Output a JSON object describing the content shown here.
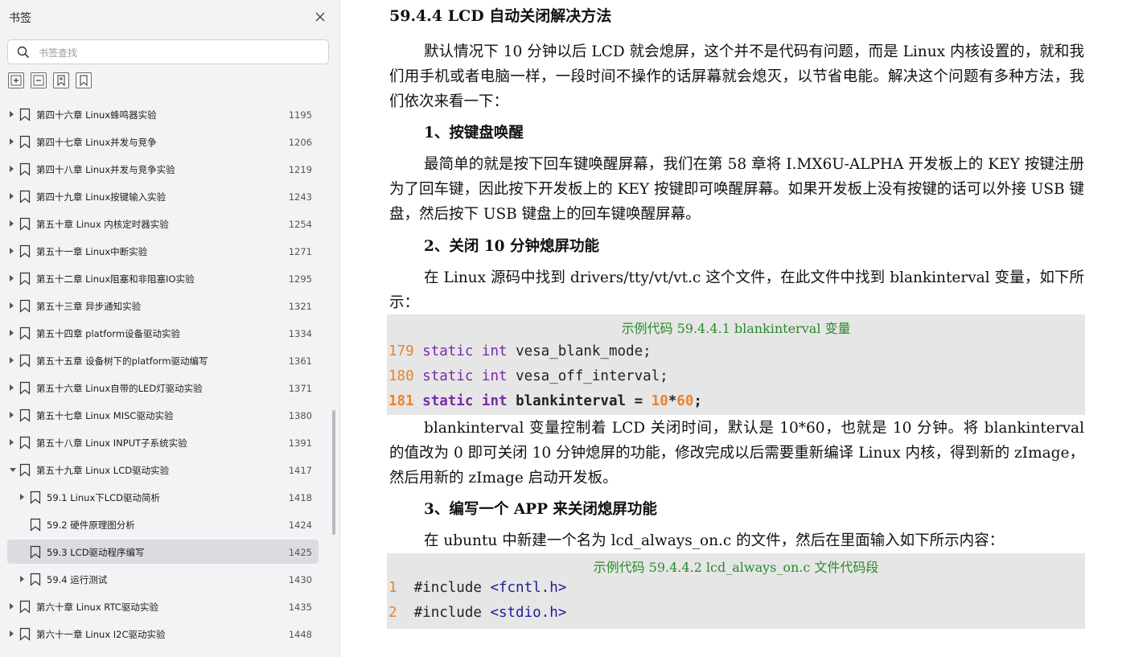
{
  "sidebar": {
    "title": "书签",
    "search_placeholder": "书签查找",
    "toc": [
      {
        "label": "第四十六章 Linux蜂鸣器实验",
        "page": "1195",
        "level": 0,
        "expand": "right",
        "active": false
      },
      {
        "label": "第四十七章 Linux并发与竞争",
        "page": "1206",
        "level": 0,
        "expand": "right",
        "active": false
      },
      {
        "label": "第四十八章 Linux并发与竞争实验",
        "page": "1219",
        "level": 0,
        "expand": "right",
        "active": false
      },
      {
        "label": "第四十九章 Linux按键输入实验",
        "page": "1243",
        "level": 0,
        "expand": "right",
        "active": false
      },
      {
        "label": "第五十章 Linux 内核定时器实验",
        "page": "1254",
        "level": 0,
        "expand": "right",
        "active": false
      },
      {
        "label": "第五十一章 Linux中断实验",
        "page": "1271",
        "level": 0,
        "expand": "right",
        "active": false
      },
      {
        "label": "第五十二章 Linux阻塞和非阻塞IO实验",
        "page": "1295",
        "level": 0,
        "expand": "right",
        "active": false
      },
      {
        "label": "第五十三章 异步通知实验",
        "page": "1321",
        "level": 0,
        "expand": "right",
        "active": false
      },
      {
        "label": "第五十四章 platform设备驱动实验",
        "page": "1334",
        "level": 0,
        "expand": "right",
        "active": false
      },
      {
        "label": "第五十五章 设备树下的platform驱动编写",
        "page": "1361",
        "level": 0,
        "expand": "right",
        "active": false
      },
      {
        "label": "第五十六章 Linux自带的LED灯驱动实验",
        "page": "1371",
        "level": 0,
        "expand": "right",
        "active": false
      },
      {
        "label": "第五十七章 Linux MISC驱动实验",
        "page": "1380",
        "level": 0,
        "expand": "right",
        "active": false
      },
      {
        "label": "第五十八章 Linux INPUT子系统实验",
        "page": "1391",
        "level": 0,
        "expand": "right",
        "active": false
      },
      {
        "label": "第五十九章 Linux LCD驱动实验",
        "page": "1417",
        "level": 0,
        "expand": "down",
        "active": false
      },
      {
        "label": "59.1 Linux下LCD驱动简析",
        "page": "1418",
        "level": 1,
        "expand": "right",
        "active": false
      },
      {
        "label": "59.2 硬件原理图分析",
        "page": "1424",
        "level": 1,
        "expand": "none",
        "active": false
      },
      {
        "label": "59.3 LCD驱动程序编写",
        "page": "1425",
        "level": 1,
        "expand": "none",
        "active": true
      },
      {
        "label": "59.4 运行测试",
        "page": "1430",
        "level": 1,
        "expand": "right",
        "active": false
      },
      {
        "label": "第六十章 Linux RTC驱动实验",
        "page": "1435",
        "level": 0,
        "expand": "right",
        "active": false
      },
      {
        "label": "第六十一章 Linux I2C驱动实验",
        "page": "1448",
        "level": 0,
        "expand": "right",
        "active": false
      }
    ]
  },
  "doc": {
    "section_title": "59.4.4 LCD 自动关闭解决方法",
    "p1": "默认情况下 10 分钟以后 LCD 就会熄屏，这个并不是代码有问题，而是 Linux 内核设置的，就和我们用手机或者电脑一样，一段时间不操作的话屏幕就会熄灭，以节省电能。解决这个问题有多种方法，我们依次来看一下：",
    "h1": "1、按键盘唤醒",
    "p2": "最简单的就是按下回车键唤醒屏幕，我们在第 58 章将 I.MX6U-ALPHA 开发板上的 KEY 按键注册为了回车键，因此按下开发板上的 KEY 按键即可唤醒屏幕。如果开发板上没有按键的话可以外接 USB 键盘，然后按下 USB 键盘上的回车键唤醒屏幕。",
    "h2": "2、关闭 10 分钟熄屏功能",
    "p3": "在 Linux 源码中找到 drivers/tty/vt/vt.c 这个文件，在此文件中找到 blankinterval 变量，如下所示：",
    "code1_caption": "示例代码 59.4.4.1 blankinterval 变量",
    "code1": [
      {
        "ln": "179",
        "kw1": "static",
        "kw2": "int",
        "rest": " vesa_blank_mode;",
        "num1": "",
        "op": "",
        "num2": "",
        "tail": "",
        "bold": false
      },
      {
        "ln": "180",
        "kw1": "static",
        "kw2": "int",
        "rest": " vesa_off_interval;",
        "num1": "",
        "op": "",
        "num2": "",
        "tail": "",
        "bold": false
      },
      {
        "ln": "181",
        "kw1": "static",
        "kw2": "int",
        "rest": " blankinterval = ",
        "num1": "10",
        "op": "*",
        "num2": "60",
        "tail": ";",
        "bold": true
      }
    ],
    "p4": "blankinterval 变量控制着 LCD 关闭时间，默认是 10*60，也就是 10 分钟。将 blankinterval 的值改为 0 即可关闭 10 分钟熄屏的功能，修改完成以后需要重新编译 Linux 内核，得到新的 zImage，然后用新的 zImage 启动开发板。",
    "h3": "3、编写一个 APP 来关闭熄屏功能",
    "p5": "在 ubuntu 中新建一个名为 lcd_always_on.c 的文件，然后在里面输入如下所示内容：",
    "code2_caption": "示例代码 59.4.4.2 lcd_always_on.c 文件代码段",
    "code2": [
      {
        "ln": "1",
        "text": "#include ",
        "hdr": "<fcntl.h>"
      },
      {
        "ln": "2",
        "text": "#include ",
        "hdr": "<stdio.h>"
      }
    ]
  }
}
